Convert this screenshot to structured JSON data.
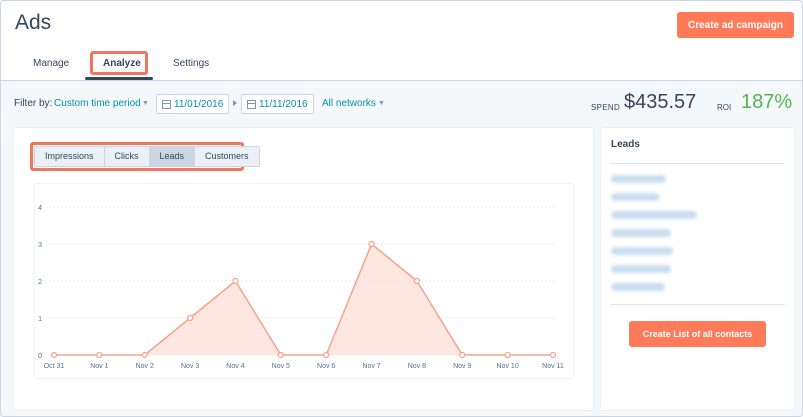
{
  "header": {
    "title": "Ads",
    "create_campaign_label": "Create ad campaign",
    "tabs": [
      {
        "label": "Manage"
      },
      {
        "label": "Analyze"
      },
      {
        "label": "Settings"
      }
    ]
  },
  "filters": {
    "label": "Filter by:",
    "time_period": "Custom time period",
    "start_date": "11/01/2016",
    "end_date": "11/11/2016",
    "network": "All networks"
  },
  "metrics": {
    "spend_label": "SPEND",
    "spend_value": "$435.57",
    "roi_label": "ROI",
    "roi_value": "187%"
  },
  "chart_tabs": [
    {
      "label": "Impressions"
    },
    {
      "label": "Clicks"
    },
    {
      "label": "Leads",
      "active": true
    },
    {
      "label": "Customers"
    }
  ],
  "leads_panel": {
    "title": "Leads",
    "create_list_label": "Create List of all contacts"
  },
  "colors": {
    "accent": "#ff7a59",
    "highlight": "#f2765c",
    "line": "#f5a38c",
    "area": "#fde3da",
    "roi": "#51b84f"
  },
  "chart_data": {
    "type": "area",
    "x": [
      "Oct 31",
      "Nov 1",
      "Nov 2",
      "Nov 3",
      "Nov 4",
      "Nov 5",
      "Nov 6",
      "Nov 7",
      "Nov 8",
      "Nov 9",
      "Nov 10",
      "Nov 11"
    ],
    "series": [
      {
        "values": [
          0,
          0,
          0,
          1,
          2,
          0,
          0,
          3,
          2,
          0,
          0,
          0
        ]
      }
    ],
    "yticks": [
      "0",
      "1",
      "2",
      "3",
      "4"
    ],
    "ylim": [
      0,
      4
    ],
    "grid": true
  }
}
